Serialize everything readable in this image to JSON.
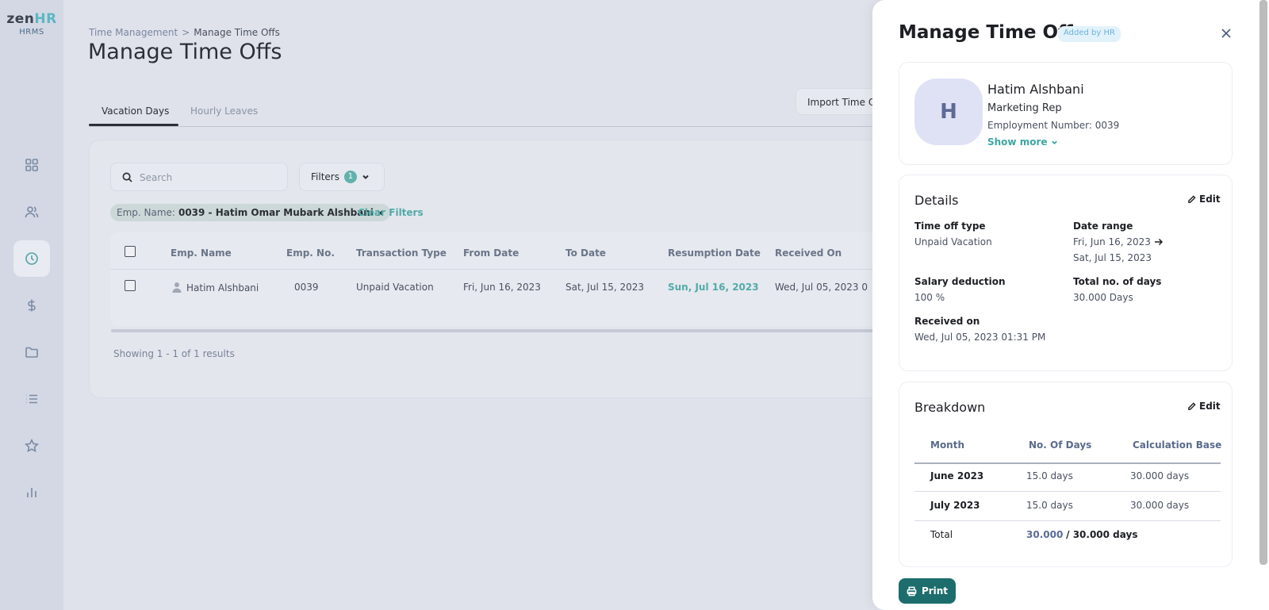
{
  "app": {
    "logo_main": "zen",
    "logo_accent": "HR",
    "logo_sub": "HRMS"
  },
  "sidebar": {
    "items": [
      "dashboard-icon",
      "users-icon",
      "clock-icon",
      "dollar-icon",
      "folder-icon",
      "list-icon",
      "star-icon",
      "chart-icon"
    ],
    "active": "clock-icon"
  },
  "breadcrumb": {
    "parent": "Time Management",
    "separator": ">",
    "current": "Manage Time Offs"
  },
  "page": {
    "title": "Manage Time Offs",
    "import_label": "Import Time Off"
  },
  "tabs": [
    {
      "label": "Vacation Days",
      "active": true
    },
    {
      "label": "Hourly Leaves",
      "active": false
    }
  ],
  "search": {
    "placeholder": "Search"
  },
  "filters": {
    "label": "Filters",
    "count": "1"
  },
  "chip": {
    "label": "Emp. Name:",
    "value": "0039 - Hatim Omar Mubark Alshbani"
  },
  "clear_filters": "Clear Filters",
  "table": {
    "headers": [
      "Emp. Name",
      "Emp. No.",
      "Transaction Type",
      "From Date",
      "To Date",
      "Resumption Date",
      "Received On"
    ],
    "rows": [
      {
        "name": "Hatim Alshbani",
        "number": "0039",
        "type": "Unpaid Vacation",
        "from": "Fri, Jun 16, 2023",
        "to": "Sat, Jul 15, 2023",
        "resumption": "Sun, Jul 16, 2023",
        "received": "Wed, Jul 05, 2023 0"
      }
    ],
    "showing": "Showing 1 - 1 of 1 results"
  },
  "drawer": {
    "title": "Manage Time Off",
    "badge": "Added by HR",
    "profile": {
      "initial": "H",
      "name": "Hatim Alshbani",
      "role": "Marketing Rep",
      "employment_number": "Employment Number: 0039",
      "show_more": "Show more"
    },
    "details": {
      "title": "Details",
      "edit": "Edit",
      "time_off_type_label": "Time off type",
      "time_off_type": "Unpaid Vacation",
      "date_range_label": "Date range",
      "date_from": "Fri, Jun 16, 2023",
      "date_to": "Sat, Jul 15, 2023",
      "salary_deduction_label": "Salary deduction",
      "salary_deduction": "100 %",
      "total_days_label": "Total no. of days",
      "total_days": "30.000 Days",
      "received_on_label": "Received on",
      "received_on": "Wed, Jul 05, 2023 01:31 PM"
    },
    "breakdown": {
      "title": "Breakdown",
      "edit": "Edit",
      "headers": [
        "Month",
        "No. Of Days",
        "Calculation Base"
      ],
      "rows": [
        {
          "month": "June 2023",
          "days": "15.0 days",
          "base": "30.000 days"
        },
        {
          "month": "July 2023",
          "days": "15.0 days",
          "base": "30.000 days"
        }
      ],
      "total_label": "Total",
      "total_used": "30.000",
      "total_max": "/ 30.000 days"
    },
    "print": "Print"
  },
  "colors": {
    "accent": "#52aaa8",
    "print_button": "#1d6d6d",
    "badge_bg": "#e2f2fa"
  }
}
